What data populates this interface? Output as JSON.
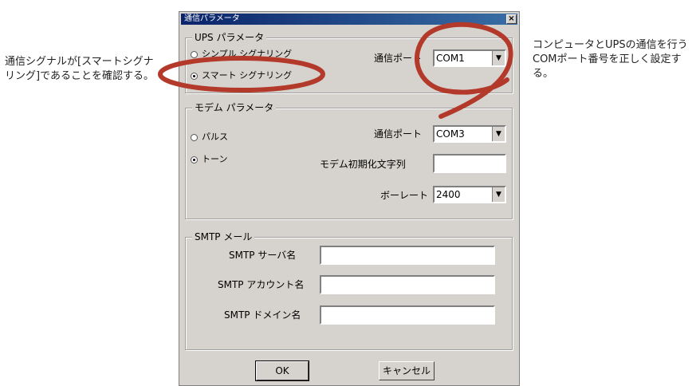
{
  "callouts": {
    "left": "通信シグナルが[スマートシグナリング]であることを確認する。",
    "right": "コンピュータとUPSの通信を行うCOMポート番号を正しく設定する。"
  },
  "dialog": {
    "title": "通信パラメータ",
    "close": "×"
  },
  "ups": {
    "group_label": "UPS パラメータ",
    "radio_simple": "シンプル シグナリング",
    "radio_smart": "スマート シグナリング",
    "port_label": "通信ポート",
    "port_value": "COM1"
  },
  "modem": {
    "group_label": "モデム パラメータ",
    "radio_pulse": "パルス",
    "radio_tone": "トーン",
    "port_label": "通信ポート",
    "port_value": "COM3",
    "init_label": "モデム初期化文字列",
    "init_value": "",
    "baud_label": "ボーレート",
    "baud_value": "2400"
  },
  "smtp": {
    "group_label": "SMTP メール",
    "server_label": "SMTP サーバ名",
    "account_label": "SMTP アカウント名",
    "domain_label": "SMTP ドメイン名"
  },
  "buttons": {
    "ok": "OK",
    "cancel": "キャンセル"
  },
  "colors": {
    "dialog_bg": "#d6d3ce",
    "annotation": "#b33a2b",
    "title_bar": "#0a246a"
  }
}
